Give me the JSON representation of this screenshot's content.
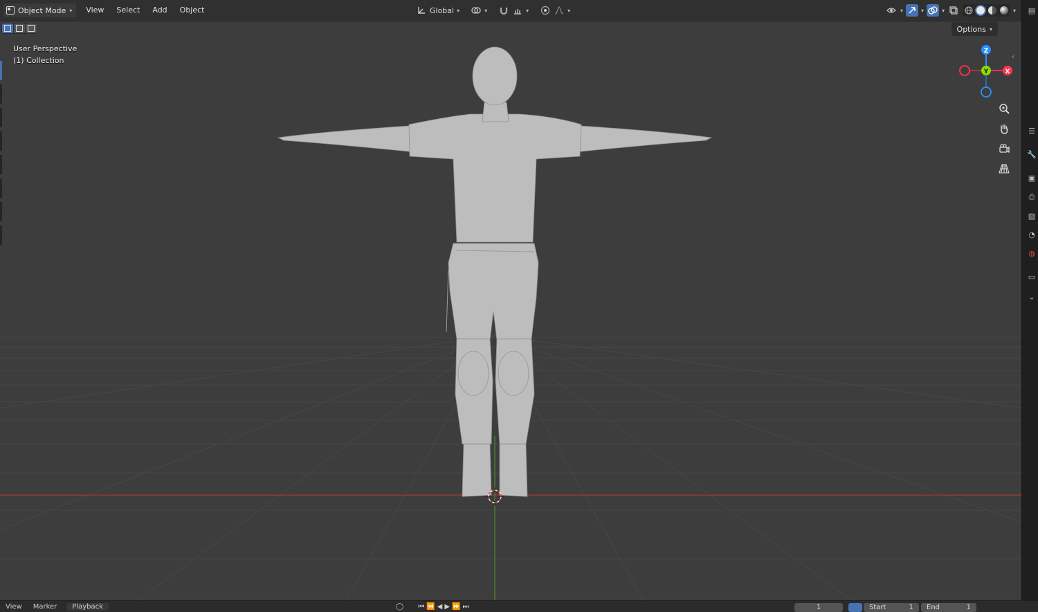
{
  "header": {
    "mode_label": "Object Mode",
    "menus": [
      "View",
      "Select",
      "Add",
      "Object"
    ],
    "transform_orientation": "Global"
  },
  "subheader": {
    "options_label": "Options"
  },
  "viewport": {
    "view_name": "User Perspective",
    "collection": "(1) Collection",
    "gizmo": {
      "x": "X",
      "y": "Y",
      "z": "Z"
    },
    "colors": {
      "x_axis": "#ff3352",
      "y_axis": "#8bdc00",
      "z_axis": "#2890ff",
      "accent": "#4772b3"
    }
  },
  "timeline": {
    "menus": [
      "View",
      "Marker",
      "Playback"
    ],
    "current_frame": "1",
    "start_label": "Start",
    "start_value": "1",
    "end_label": "End",
    "end_value": "1"
  }
}
